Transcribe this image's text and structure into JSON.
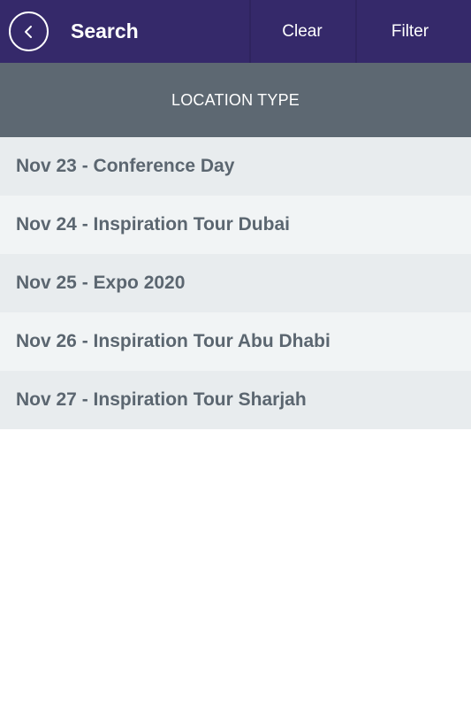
{
  "header": {
    "title": "Search",
    "clear_label": "Clear",
    "filter_label": "Filter",
    "back_icon": "chevron-left-icon",
    "background": "#35296a"
  },
  "section": {
    "title": "LOCATION TYPE",
    "background": "#5d6872"
  },
  "list": {
    "items": [
      {
        "label": "Nov 23 - Conference Day"
      },
      {
        "label": "Nov 24 - Inspiration Tour Dubai"
      },
      {
        "label": "Nov 25 - Expo 2020"
      },
      {
        "label": "Nov 26 - Inspiration Tour Abu Dhabi"
      },
      {
        "label": "Nov 27 - Inspiration Tour Sharjah"
      }
    ],
    "row_colors": [
      "#e8ecee",
      "#f1f4f5"
    ],
    "text_color": "#5b6670"
  }
}
